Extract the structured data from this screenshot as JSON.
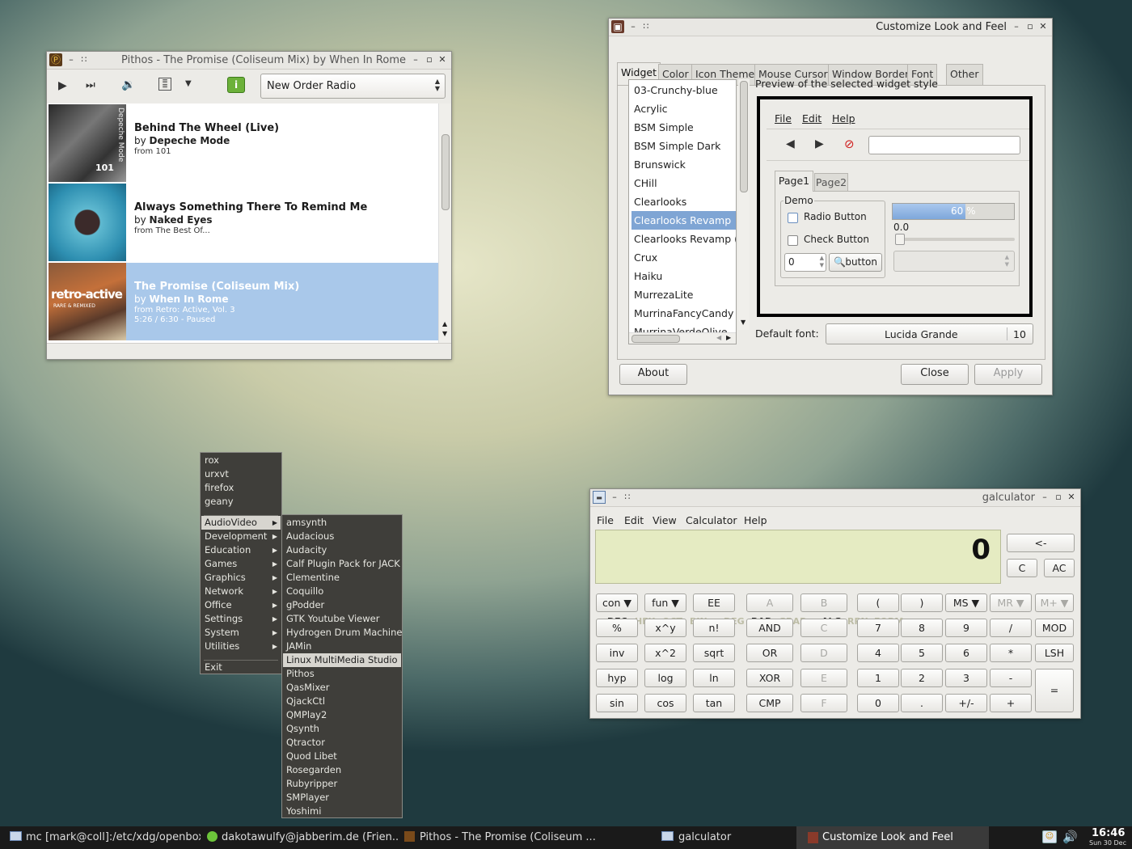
{
  "pithos": {
    "title": "Pithos - The Promise (Coliseum Mix) by When In Rome",
    "station": "New Order Radio",
    "songs": [
      {
        "title": "Behind The Wheel (Live)",
        "by": "by",
        "artist": "Depeche Mode",
        "album": "from 101",
        "status": "",
        "art_text": "Depeche Mode",
        "art_sub": "101"
      },
      {
        "title": "Always Something There To Remind Me",
        "by": "by",
        "artist": "Naked Eyes",
        "album": "from The Best Of...",
        "status": "",
        "art_text": "",
        "art_sub": ""
      },
      {
        "title": "The Promise (Coliseum Mix)",
        "by": "by",
        "artist": "When In Rome",
        "album": "from Retro: Active, Vol. 3",
        "status": "5:26 / 6:30 - Paused",
        "art_text": "retro-active",
        "art_sub": "RARE & REMIXED"
      }
    ]
  },
  "lxappearance": {
    "title": "Customize Look and Feel",
    "tabs": [
      "Widget",
      "Color",
      "Icon Theme",
      "Mouse Cursor",
      "Window Border",
      "Font",
      "Other"
    ],
    "themes": [
      "03-Crunchy-blue",
      "Acrylic",
      "BSM Simple",
      "BSM Simple Dark",
      "Brunswick",
      "CHill",
      "Clearlooks",
      "Clearlooks Revamp",
      "Clearlooks Revamp (cl",
      "Crux",
      "Haiku",
      "MurrezaLite",
      "MurrinaFancyCandy",
      "MurrinaVerdeOlive"
    ],
    "selected_theme": "Clearlooks Revamp",
    "preview_label": "Preview of the selected widget style",
    "preview_menu": [
      "File",
      "Edit",
      "Help"
    ],
    "preview_tabs": [
      "Page1",
      "Page2"
    ],
    "demo_label": "Demo",
    "radio_label": "Radio Button",
    "check_label": "Check Button",
    "progress_text": "60 %",
    "progress": 0.6,
    "scale_value": "0.0",
    "spin_value": "0",
    "preview_button": "button",
    "default_font_label": "Default font:",
    "font_name": "Lucida Grande",
    "font_size": "10",
    "about": "About",
    "close": "Close",
    "apply": "Apply"
  },
  "menu": {
    "top_items": [
      "rox",
      "urxvt",
      "firefox",
      "geany"
    ],
    "categories": [
      "AudioVideo",
      "Development",
      "Education",
      "Games",
      "Graphics",
      "Network",
      "Office",
      "Settings",
      "System",
      "Utilities"
    ],
    "exit": "Exit",
    "submenu": [
      "amsynth",
      "Audacious",
      "Audacity",
      "Calf Plugin Pack for JACK",
      "Clementine",
      "Coquillo",
      "gPodder",
      "GTK Youtube Viewer",
      "Hydrogen Drum Machine",
      "JAMin",
      "Linux MultiMedia Studio",
      "Pithos",
      "QasMixer",
      "QjackCtl",
      "QMPlay2",
      "Qsynth",
      "Qtractor",
      "Quod Libet",
      "Rosegarden",
      "Rubyripper",
      "SMPlayer",
      "Yoshimi"
    ],
    "selected_sub": "Linux MultiMedia Studio"
  },
  "calc": {
    "title": "galculator",
    "menu": [
      "File",
      "Edit",
      "View",
      "Calculator",
      "Help"
    ],
    "display": "0",
    "modes": [
      "DEC",
      "HEX",
      "OCT",
      "BIN",
      "DEG",
      "RAD",
      "GRAD",
      "ALG",
      "RPN",
      "FORM"
    ],
    "right_buttons": [
      "<-",
      "C",
      "AC"
    ],
    "rows": [
      [
        "con ▼",
        "fun ▼",
        "EE",
        "A",
        "B",
        "(",
        ")",
        "MS ▼",
        "MR ▼",
        "M+ ▼"
      ],
      [
        "%",
        "x^y",
        "n!",
        "AND",
        "C",
        "7",
        "8",
        "9",
        "/",
        "MOD"
      ],
      [
        "inv",
        "x^2",
        "sqrt",
        "OR",
        "D",
        "4",
        "5",
        "6",
        "*",
        "LSH"
      ],
      [
        "hyp",
        "log",
        "ln",
        "XOR",
        "E",
        "1",
        "2",
        "3",
        "-",
        "="
      ],
      [
        "sin",
        "cos",
        "tan",
        "CMP",
        "F",
        "0",
        ".",
        "+/-",
        "+",
        ""
      ]
    ]
  },
  "taskbar": {
    "tasks": [
      "mc [mark@coll]:/etc/xdg/openbox",
      "dakotawulfy@jabberim.de (Frien...",
      "Pithos - The Promise (Coliseum ...",
      "galculator",
      "Customize Look and Feel"
    ],
    "time": "16:46",
    "date": "Sun 30 Dec"
  },
  "colors": {
    "selection": "#7fa5d4",
    "menu_bg": "#3f3e3a",
    "calc_display": "#e5ebc2",
    "taskbar": "#1a1a1a"
  }
}
